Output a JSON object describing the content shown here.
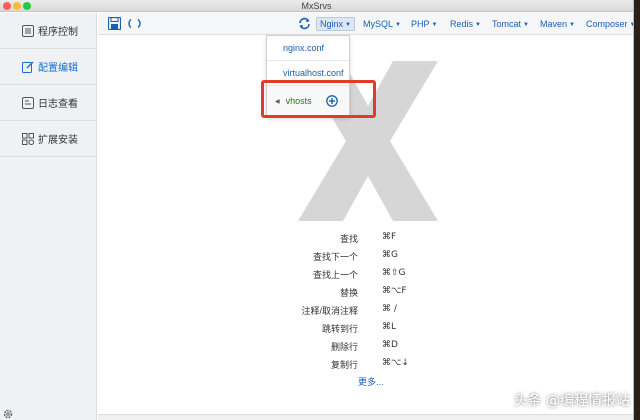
{
  "window": {
    "title": "MxSrvs"
  },
  "sidebar": {
    "items": [
      {
        "label": "程序控制",
        "icon": "list-icon",
        "active": false
      },
      {
        "label": "配置编辑",
        "icon": "edit-icon",
        "active": true
      },
      {
        "label": "日志查看",
        "icon": "log-icon",
        "active": false
      },
      {
        "label": "扩展安装",
        "icon": "grid-icon",
        "active": false
      }
    ]
  },
  "toolbar": {
    "menus": [
      {
        "label": "Nginx",
        "active": true
      },
      {
        "label": "MySQL",
        "active": false
      },
      {
        "label": "PHP",
        "active": false
      },
      {
        "label": "Redis",
        "active": false
      },
      {
        "label": "Tomcat",
        "active": false
      },
      {
        "label": "Maven",
        "active": false
      },
      {
        "label": "Composer",
        "active": false
      }
    ]
  },
  "dropdown": {
    "items": [
      "nginx.conf",
      "virtualhost.conf"
    ],
    "submenu": {
      "label": "vhosts"
    }
  },
  "shortcuts": [
    {
      "name": "查找",
      "key": "⌘F"
    },
    {
      "name": "查找下一个",
      "key": "⌘G"
    },
    {
      "name": "查找上一个",
      "key": "⌘⇧G"
    },
    {
      "name": "替换",
      "key": "⌘⌥F"
    },
    {
      "name": "注释/取消注释",
      "key": "⌘ /"
    },
    {
      "name": "跳转到行",
      "key": "⌘L"
    },
    {
      "name": "删除行",
      "key": "⌘D"
    },
    {
      "name": "复制行",
      "key": "⌘⌥↓"
    }
  ],
  "more_link": "更多...",
  "watermark": "头条 @编程情报站",
  "colors": {
    "accent": "#1a5fb4",
    "highlight": "#e23b2a",
    "active_sidebar": "#1a6fd6"
  }
}
